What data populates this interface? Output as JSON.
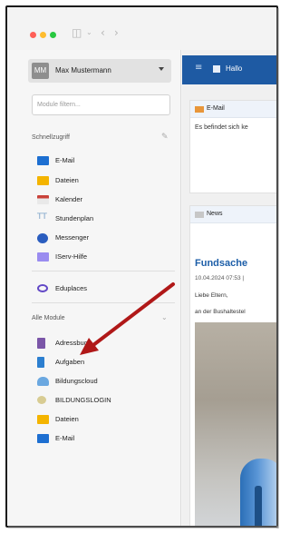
{
  "user": {
    "initials": "MM",
    "name": "Max Mustermann"
  },
  "filter": {
    "placeholder": "Module filtern..."
  },
  "quick_access": {
    "title": "Schnellzugriff",
    "items": [
      {
        "label": "E-Mail",
        "icon": "mail-icon",
        "color": "#1d6fd1"
      },
      {
        "label": "Dateien",
        "icon": "folder-icon",
        "color": "#f4b400"
      },
      {
        "label": "Kalender",
        "icon": "calendar-icon",
        "color": "#c9423a"
      },
      {
        "label": "Stundenplan",
        "icon": "timetable-icon",
        "color": "#7fa5c9"
      },
      {
        "label": "Messenger",
        "icon": "chat-icon",
        "color": "#2a5dbf"
      },
      {
        "label": "IServ-Hilfe",
        "icon": "help-icon",
        "color": "#9a8cf0"
      }
    ]
  },
  "eduplaces": {
    "label": "Eduplaces",
    "icon": "eduplaces-icon",
    "color": "#6248c6"
  },
  "all_modules": {
    "title": "Alle Module",
    "items": [
      {
        "label": "Adressbuch",
        "icon": "addressbook-icon",
        "color": "#7b56a8"
      },
      {
        "label": "Aufgaben",
        "icon": "tasks-icon",
        "color": "#2c7fd0"
      },
      {
        "label": "Bildungscloud",
        "icon": "cloud-icon",
        "color": "#6ba8e0"
      },
      {
        "label": "BILDUNGSLOGIN",
        "icon": "login-icon",
        "color": "#d8cc93"
      },
      {
        "label": "Dateien",
        "icon": "folder-icon",
        "color": "#f4b400"
      },
      {
        "label": "E-Mail",
        "icon": "mail-icon",
        "color": "#1d6fd1"
      }
    ]
  },
  "topnav": {
    "crumb": "Hallo"
  },
  "mail_card": {
    "title": "E-Mail",
    "text": "Es befindet sich ke"
  },
  "news_card": {
    "title": "News",
    "headline": "Fundsache",
    "date": "10.04.2024 07:53 |",
    "lines": [
      "Liebe Eltern,",
      "an der Bushaltestel"
    ]
  },
  "colors": {
    "accent": "#1e5aa3",
    "arrow": "#b01818",
    "window_dot_red": "#ff5f57",
    "window_dot_yellow": "#febc2e",
    "window_dot_green": "#28c840"
  }
}
